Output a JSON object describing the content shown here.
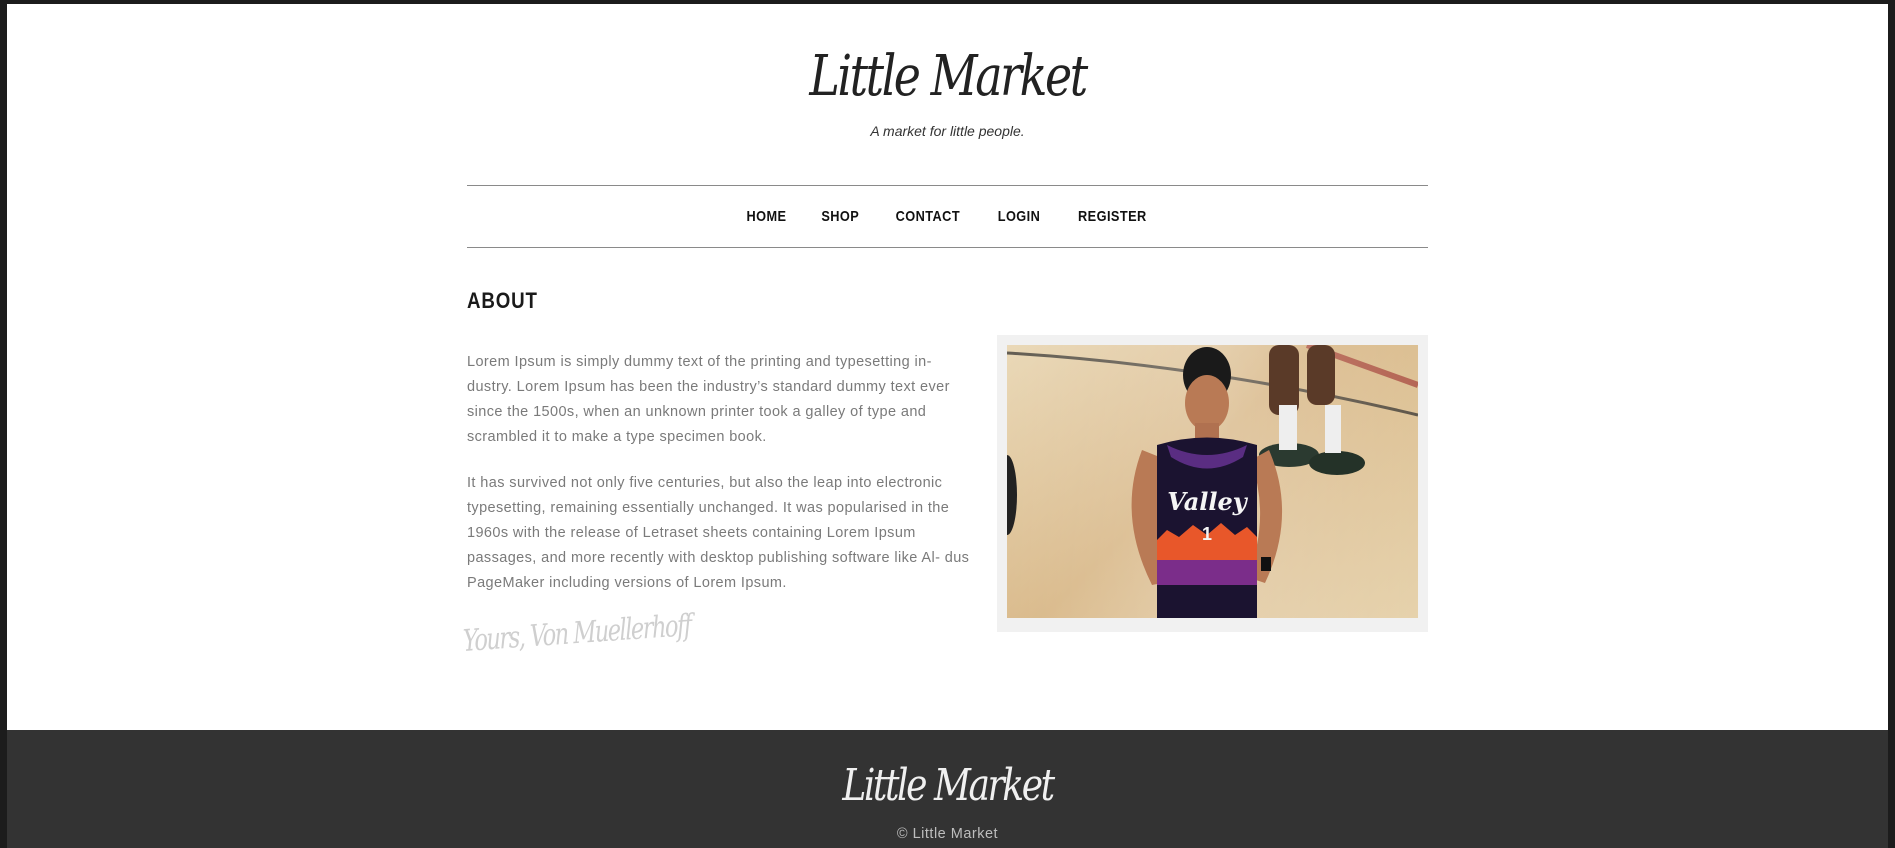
{
  "header": {
    "brand": "Little Market",
    "tagline": "A market for little people."
  },
  "nav": {
    "items": [
      "HOME",
      "SHOP",
      "CONTACT",
      "LOGIN",
      "REGISTER"
    ]
  },
  "about": {
    "title": "ABOUT",
    "paragraph1": "Lorem Ipsum is simply dummy text of the printing and typesetting in- dustry. Lorem Ipsum has been the industry’s standard dummy text ever since the 1500s, when an unknown printer took a galley of type and scrambled it to make a type specimen book.",
    "paragraph2": "It has survived not only five centuries, but also the leap into electronic typesetting, remaining essentially unchanged. It was popularised in the 1960s with the release of Letraset sheets containing Lorem Ipsum passages, and more recently with desktop publishing software like Al- dus PageMaker including versions of Lorem Ipsum.",
    "signature": "Yours, Von Muellerhoff",
    "photo_jersey_text": "Valley",
    "photo_jersey_number": "1"
  },
  "footer": {
    "brand": "Little Market",
    "copyright": "© Little Market"
  },
  "colors": {
    "background_frame": "#1c1c1c",
    "page": "#ffffff",
    "footer": "#333333",
    "body_text": "#7a7a7a",
    "rule": "#8a8a8a"
  }
}
